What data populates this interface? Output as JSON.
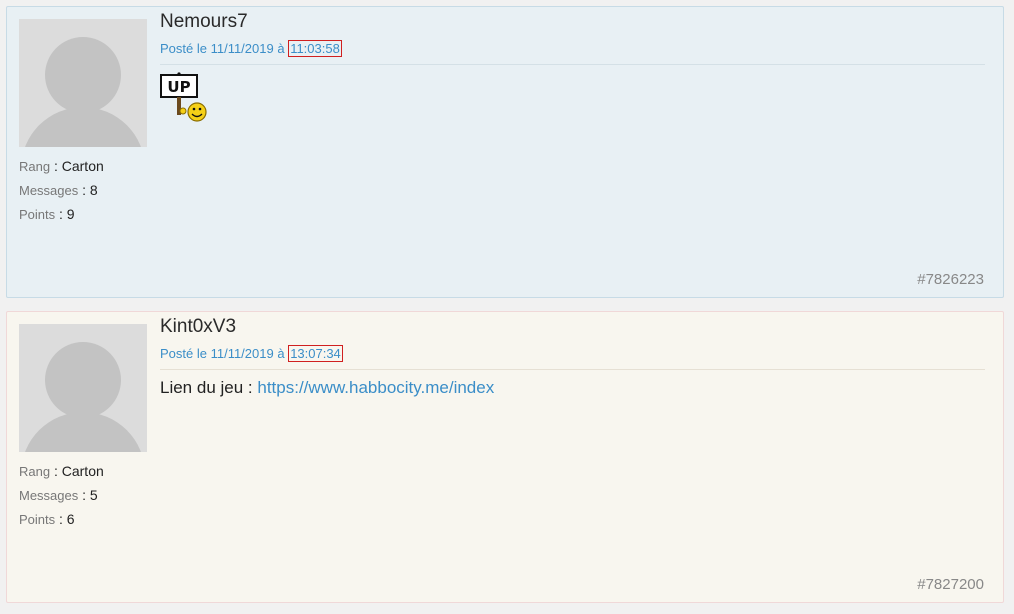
{
  "posts": [
    {
      "author": "Nemours7",
      "posted_prefix": "Posté le 11/11/2019 à",
      "time": "11:03:58",
      "content_type": "smiley",
      "smiley_icon": "up-sign-smiley-icon",
      "smiley_text": "UP",
      "rank_label": "Rang",
      "rank_value": ": Carton",
      "messages_label": "Messages",
      "messages_value": ": 8",
      "points_label": "Points",
      "points_value": ": 9",
      "post_id": "#7826223"
    },
    {
      "author": "Kint0xV3",
      "posted_prefix": "Posté le 11/11/2019 à",
      "time": "13:07:34",
      "content_type": "text",
      "content_text": "Lien du jeu : ",
      "content_link": "https://www.habbocity.me/index",
      "rank_label": "Rang",
      "rank_value": ": Carton",
      "messages_label": "Messages",
      "messages_value": ": 5",
      "points_label": "Points",
      "points_value": ": 6",
      "post_id": "#7827200"
    }
  ],
  "colors": {
    "post1_bg": "#e8f0f4",
    "post2_bg": "#f8f6ef",
    "link": "#3b8ec8",
    "time_border": "#d02020"
  }
}
